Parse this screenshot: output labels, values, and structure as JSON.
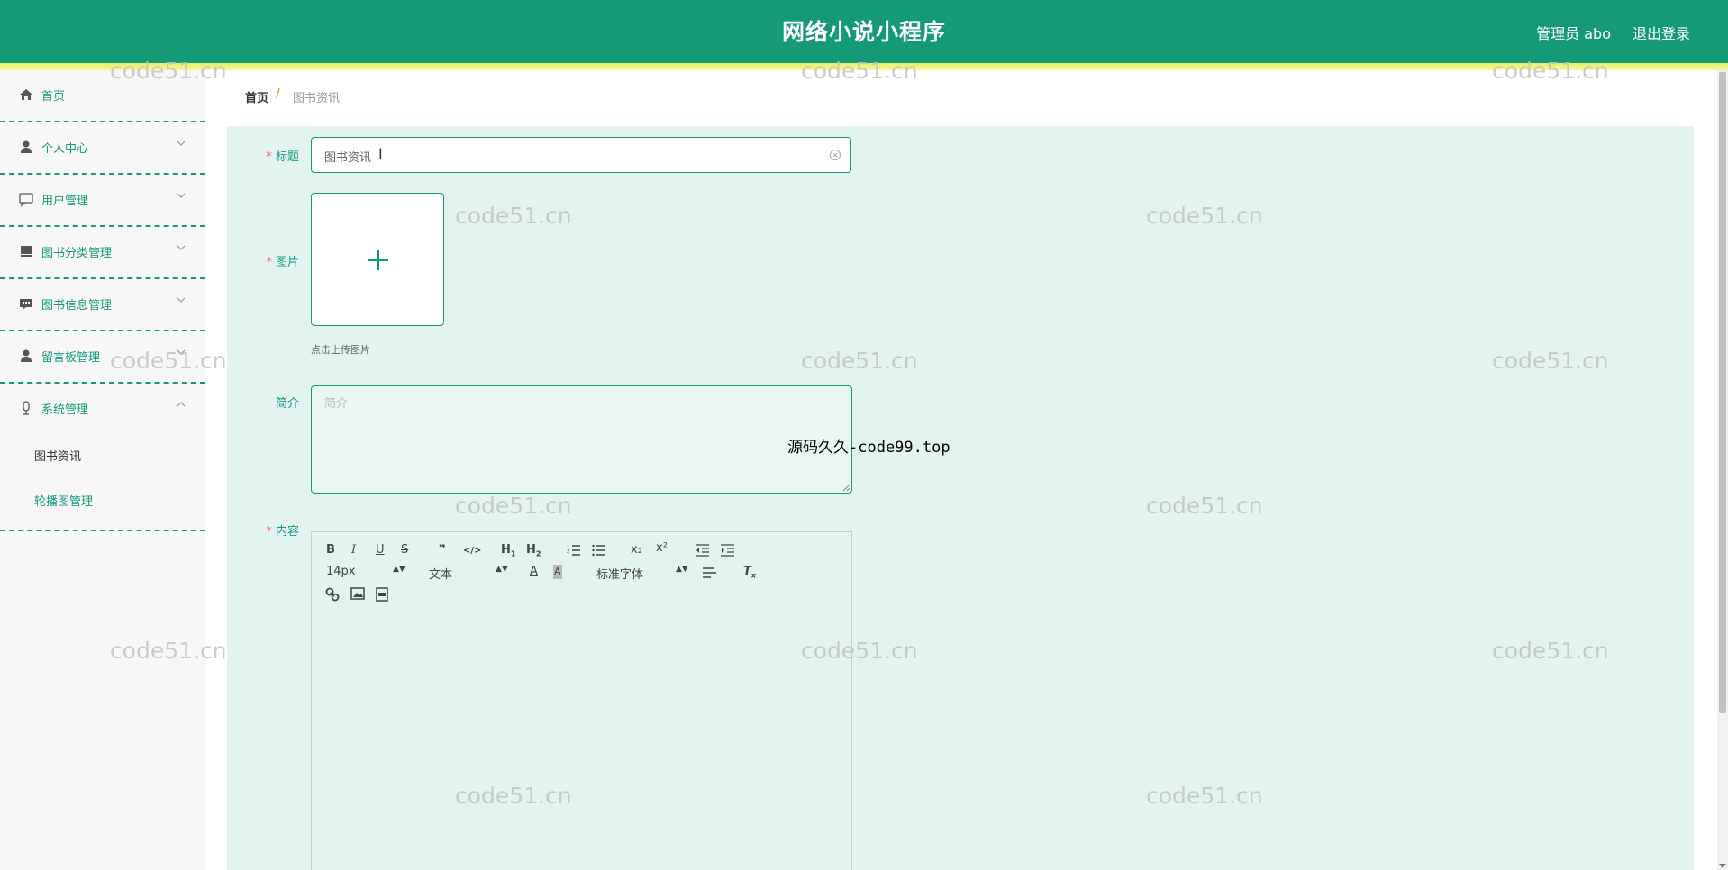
{
  "header": {
    "app_title": "网络小说小程序",
    "admin_label": "管理员 abo",
    "logout_label": "退出登录",
    "accent_color": "#159a78"
  },
  "sidebar": {
    "items": [
      {
        "label": "首页",
        "icon": "home-icon"
      },
      {
        "label": "个人中心",
        "icon": "user-icon"
      },
      {
        "label": "用户管理",
        "icon": "chat-icon"
      },
      {
        "label": "图书分类管理",
        "icon": "book-icon"
      },
      {
        "label": "图书信息管理",
        "icon": "message-icon"
      },
      {
        "label": "留言板管理",
        "icon": "user-icon"
      },
      {
        "label": "系统管理",
        "icon": "microphone-icon"
      }
    ],
    "submenu": [
      {
        "label": "图书资讯"
      },
      {
        "label": "轮播图管理"
      }
    ]
  },
  "breadcrumb": {
    "home": "首页",
    "separator": "/",
    "current": "图书资讯"
  },
  "form": {
    "title_label": "标题",
    "title_value": "图书资讯",
    "image_label": "图片",
    "upload_hint": "点击上传图片",
    "intro_label": "简介",
    "intro_placeholder": "简介",
    "content_label": "内容",
    "required_mark": "*"
  },
  "editor_toolbar": {
    "row1": [
      "B",
      "I",
      "U",
      "S",
      "❞",
      "</>",
      "H1",
      "H2",
      "ol",
      "ul",
      "x₂",
      "x²",
      "outdent",
      "indent"
    ],
    "font_size": "14px",
    "block_type": "文本",
    "font_family": "标准字体"
  },
  "watermarks": {
    "text": "code51.cn",
    "overlay_text": "源码久久-code99.top"
  }
}
